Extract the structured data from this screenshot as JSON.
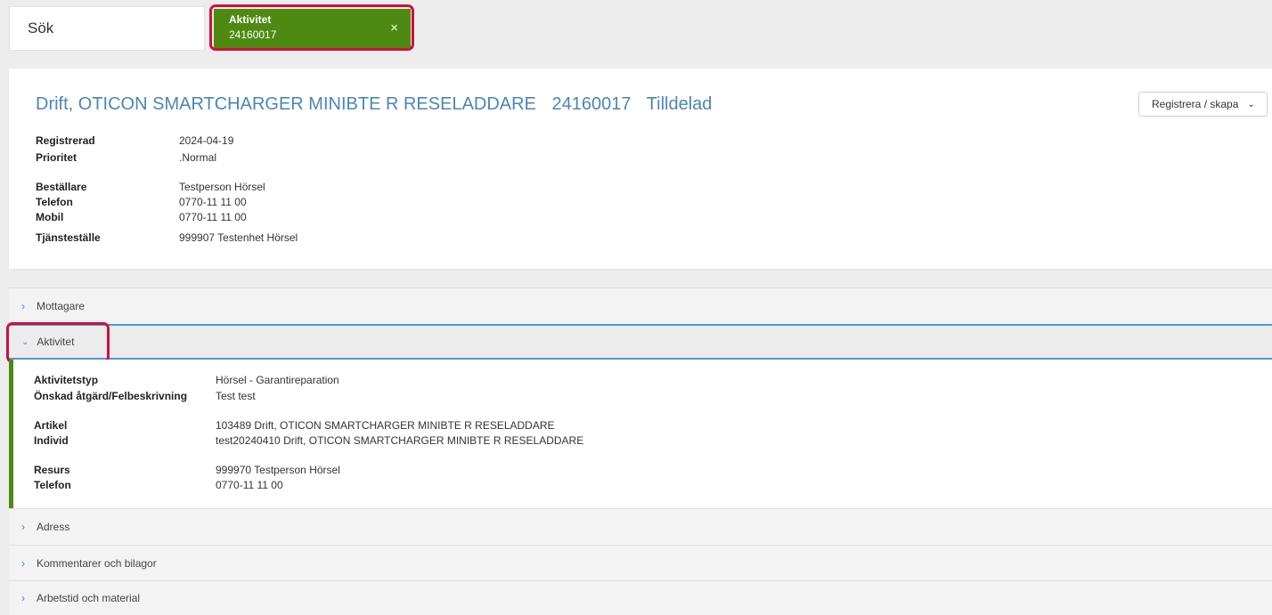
{
  "tabs": {
    "search_label": "Sök",
    "active": {
      "title": "Aktivitet",
      "number": "24160017",
      "close": "×"
    }
  },
  "header": {
    "title_parts": [
      "Drift, OTICON SMARTCHARGER MINIBTE R RESELADDARE",
      "24160017",
      "Tilldelad"
    ],
    "register_button": "Registrera / skapa",
    "fields": {
      "registrerad": {
        "label": "Registrerad",
        "value": "2024-04-19"
      },
      "prioritet": {
        "label": "Prioritet",
        "value": ".Normal"
      },
      "bestallare": {
        "label": "Beställare",
        "value": "Testperson Hörsel"
      },
      "telefon": {
        "label": "Telefon",
        "value": "0770-11 11 00"
      },
      "mobil": {
        "label": "Mobil",
        "value": "0770-11 11 00"
      },
      "tjanstestalle": {
        "label": "Tjänsteställe",
        "value": "999907 Testenhet Hörsel"
      }
    }
  },
  "sections": {
    "mottagare": "Mottagare",
    "aktivitet": "Aktivitet",
    "adress": "Adress",
    "kommentarer": "Kommentarer och bilagor",
    "arbetstid": "Arbetstid och material"
  },
  "aktivitet_details": {
    "aktivitetstyp": {
      "label": "Aktivitetstyp",
      "value": "Hörsel - Garantireparation"
    },
    "atgard": {
      "label": "Önskad åtgärd/Felbeskrivning",
      "value": "Test test"
    },
    "artikel": {
      "label": "Artikel",
      "value": "103489 Drift, OTICON SMARTCHARGER MINIBTE R RESELADDARE"
    },
    "individ": {
      "label": "Individ",
      "value": "test20240410 Drift, OTICON SMARTCHARGER MINIBTE R RESELADDARE"
    },
    "resurs": {
      "label": "Resurs",
      "value": "999970 Testperson Hörsel"
    },
    "telefon": {
      "label": "Telefon",
      "value": "0770-11 11 00"
    }
  },
  "colors": {
    "accent_green": "#4e8a12",
    "title_blue": "#4a86b8",
    "highlight_red": "#d0103a"
  }
}
